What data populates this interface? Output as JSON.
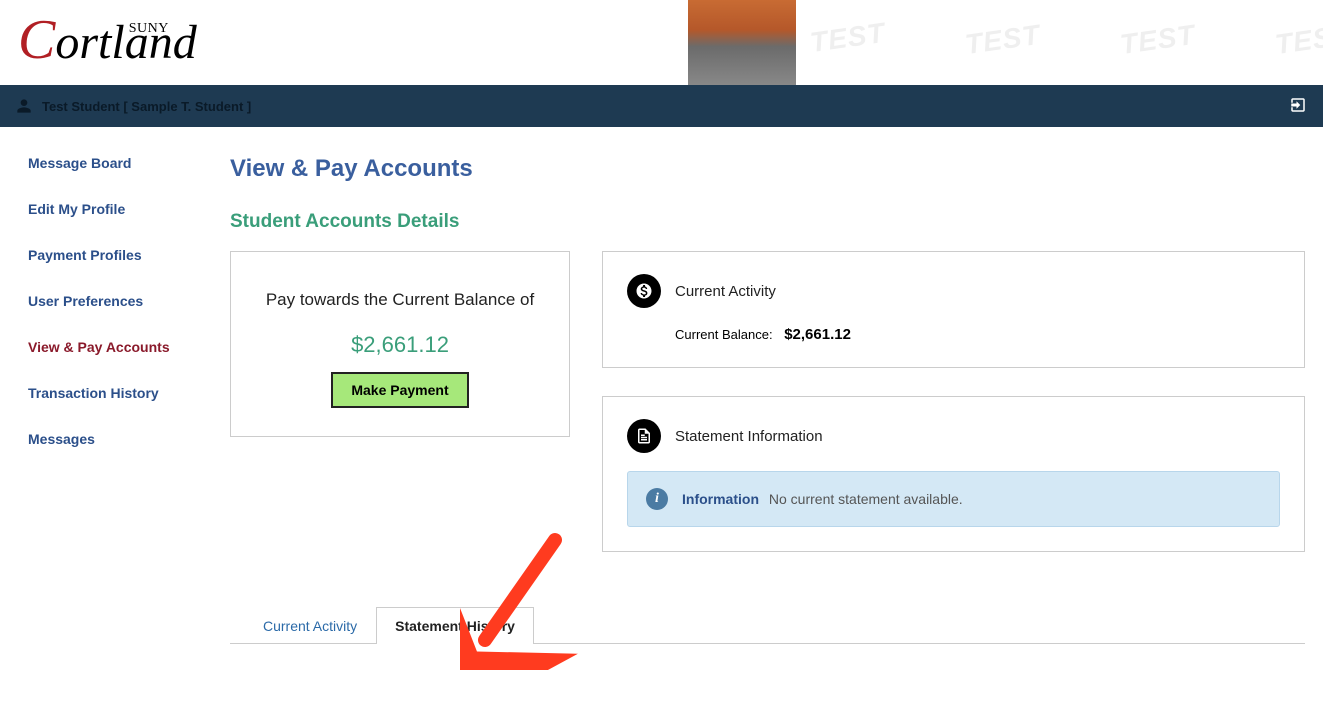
{
  "header": {
    "logo_text": "ortland",
    "logo_prefix": "C",
    "logo_sup": "SUNY",
    "watermark": "TEST"
  },
  "userbar": {
    "name": "Test Student [ Sample T. Student ]"
  },
  "sidebar": {
    "items": [
      {
        "label": "Message Board",
        "active": false
      },
      {
        "label": "Edit My Profile",
        "active": false
      },
      {
        "label": "Payment Profiles",
        "active": false
      },
      {
        "label": "User Preferences",
        "active": false
      },
      {
        "label": "View & Pay Accounts",
        "active": true
      },
      {
        "label": "Transaction History",
        "active": false
      },
      {
        "label": "Messages",
        "active": false
      }
    ]
  },
  "main": {
    "page_title": "View & Pay Accounts",
    "sub_title": "Student Accounts Details",
    "pay_card": {
      "label": "Pay towards the Current Balance of",
      "amount": "$2,661.12",
      "button": "Make Payment"
    },
    "activity_card": {
      "title": "Current Activity",
      "balance_label": "Current Balance:",
      "balance_value": "$2,661.12"
    },
    "statement_card": {
      "title": "Statement Information",
      "alert_title": "Information",
      "alert_msg": "No current statement available."
    },
    "tabs": [
      {
        "label": "Current Activity",
        "active": false
      },
      {
        "label": "Statement History",
        "active": true
      }
    ]
  }
}
